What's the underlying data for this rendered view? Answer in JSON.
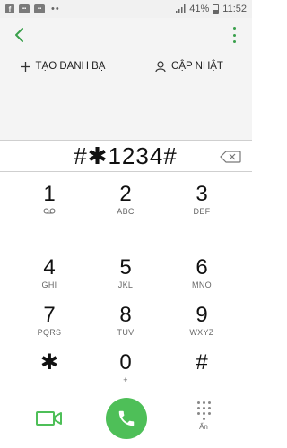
{
  "status_bar": {
    "battery": "41%",
    "time": "11:52",
    "left_icons": [
      "facebook-icon",
      "app-notification-icon",
      "app-notification-icon",
      "more-notifications-icon"
    ],
    "right_icons": [
      "signal-icon",
      "battery-icon"
    ]
  },
  "top_bar": {
    "back_icon": "chevron-left-icon",
    "more_icon": "more-vertical-icon"
  },
  "actions": {
    "create_contact_label": "TẠO DANH BẠ",
    "update_label": "CẬP NHẬT"
  },
  "dialer": {
    "number": "#✱1234#"
  },
  "keypad": [
    {
      "digit": "1",
      "letters": ""
    },
    {
      "digit": "2",
      "letters": "ABC"
    },
    {
      "digit": "3",
      "letters": "DEF"
    },
    {
      "digit": "4",
      "letters": "GHI"
    },
    {
      "digit": "5",
      "letters": "JKL"
    },
    {
      "digit": "6",
      "letters": "MNO"
    },
    {
      "digit": "7",
      "letters": "PQRS"
    },
    {
      "digit": "8",
      "letters": "TUV"
    },
    {
      "digit": "9",
      "letters": "WXYZ"
    },
    {
      "digit": "✱",
      "letters": ""
    },
    {
      "digit": "0",
      "letters": "+"
    },
    {
      "digit": "#",
      "letters": ""
    }
  ],
  "bottom": {
    "hide_label": "Ẩn"
  },
  "colors": {
    "accent": "#3aa04c",
    "call_button": "#4ebf58",
    "background": "#f4f4f4"
  }
}
